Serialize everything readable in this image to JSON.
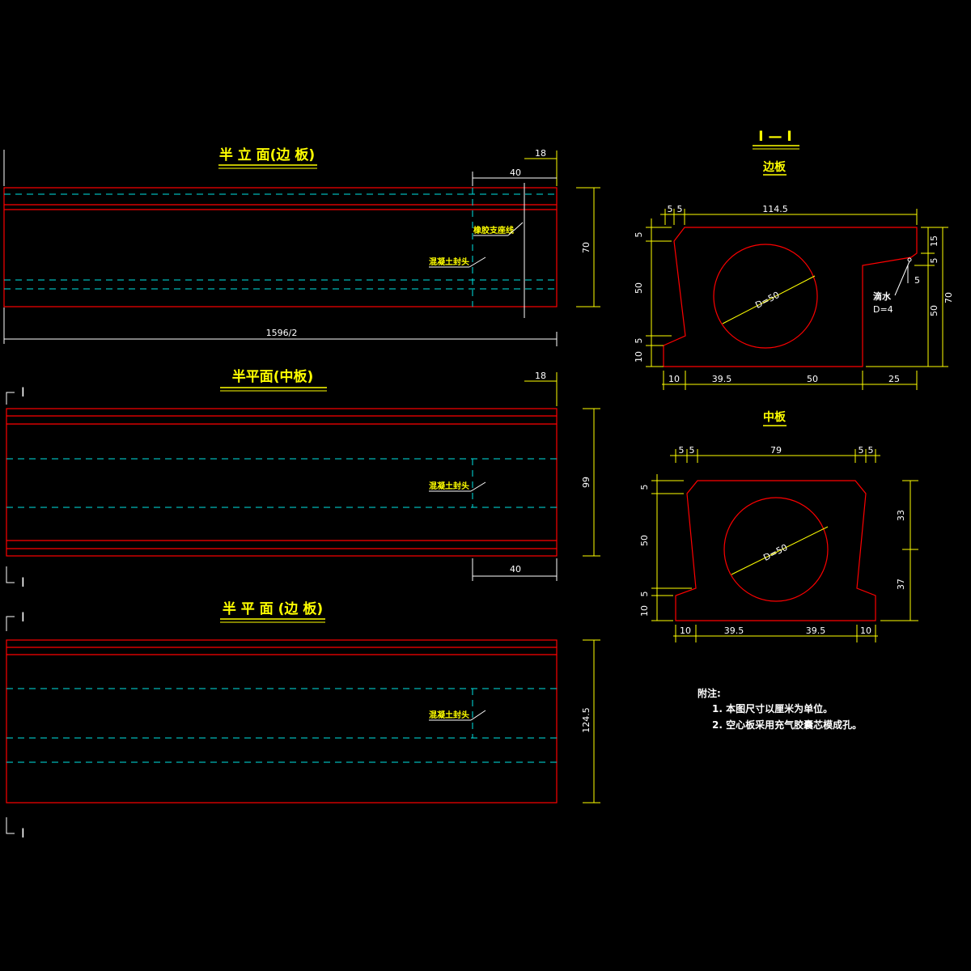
{
  "views": {
    "elev_edge": {
      "title": "半 立 面(边 板)",
      "dim_top": "18",
      "dim_40": "40",
      "dim_70": "70",
      "dim_len": "1596/2",
      "label_support": "橡胶支座线",
      "label_seal": "混凝土封头"
    },
    "plan_mid": {
      "title": "半平面(中板)",
      "dim_top": "18",
      "dim_99": "99",
      "dim_40": "40",
      "label_seal": "混凝土封头",
      "section_mark": "I"
    },
    "plan_edge": {
      "title": "半 平 面 (边 板)",
      "dim_1245": "124.5",
      "label_seal": "混凝土封头",
      "section_mark": "I"
    }
  },
  "section": {
    "title": "I — I",
    "edge": {
      "subtitle": "边板",
      "dim_top_5a": "5",
      "dim_top_5b": "5",
      "dim_top": "114.5",
      "dim_l5": "5",
      "dim_l50": "50",
      "dim_l5b": "5",
      "dim_l10": "10",
      "dim_r15": "15",
      "dim_r5": "5",
      "dim_r50": "50",
      "dim_r70": "70",
      "dim_b10": "10",
      "dim_b395": "39.5",
      "dim_b50": "50",
      "dim_b25": "25",
      "circle": "D=50",
      "drip_label": "滴水",
      "drip_d": "D=4",
      "drip_5": "5"
    },
    "mid": {
      "subtitle": "中板",
      "dim_top_5a": "5",
      "dim_top_5b": "5",
      "dim_top": "79",
      "dim_top_5c": "5",
      "dim_top_5d": "5",
      "dim_l5": "5",
      "dim_l50": "50",
      "dim_l5b": "5",
      "dim_l10": "10",
      "dim_r33": "33",
      "dim_r37": "37",
      "dim_b10a": "10",
      "dim_b395a": "39.5",
      "dim_b395b": "39.5",
      "dim_b10b": "10",
      "circle": "D=50"
    }
  },
  "notes": {
    "heading": "附注:",
    "items": [
      "1. 本图尺寸以厘米为单位。",
      "2. 空心板采用充气胶囊芯模成孔。"
    ]
  }
}
